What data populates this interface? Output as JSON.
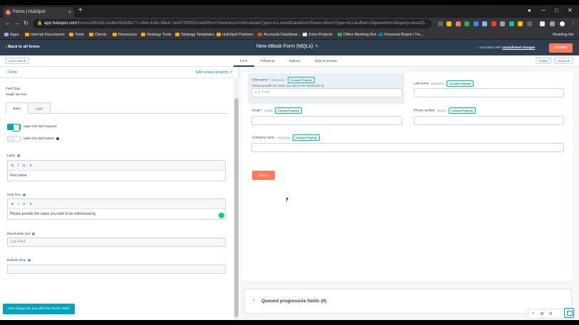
{
  "browser": {
    "tab_title": "Forms | HubSpot",
    "tab_close": "×",
    "new_tab": "+",
    "url_host": "app.hubspot.com",
    "url_path": "/forms/2661831/editor/8d5dfe77-c4b4-416e-98e4-7a49705f0501/edit/form?businessUnitId=&dateType=ALL&endDate&formTeam=&formType=ALL&offset=0&parentId=0&query=&sortD...",
    "bookmarks": [
      "Apps",
      "Internal Documents",
      "Tools",
      "Clients",
      "Resources",
      "Strategy Tools",
      "Strategy Templates",
      "HubSpot Partners",
      "Accounts Dashboar...",
      "Zoho Projects",
      "Office Working Rot...",
      "Personal Board | Tre..."
    ],
    "reading_list": "Reading list"
  },
  "header": {
    "back_label": "Back to all forms",
    "form_title": "New eBook Form (MQLs)",
    "autosave_prefix": "Automated with",
    "autosave_changes": "unpublished changes",
    "update_label": "Update"
  },
  "subheader": {
    "learn_more": "Learn more",
    "tabs": [
      "Form",
      "Follow-up",
      "Options",
      "Style & preview"
    ],
    "active_tab": "Form",
    "embed_label": "Embed",
    "actions_label": "Actions"
  },
  "left_panel": {
    "done_label": "Done",
    "edit_property_label": "Edit contact property",
    "field_type_label": "Field Type",
    "field_type_value": "Single line text",
    "tabs": [
      "Basic",
      "Logic"
    ],
    "required_toggle_label": "Make this field required",
    "required_on": true,
    "hidden_toggle_label": "Make this field hidden",
    "hidden_on": false,
    "label_label": "Label",
    "label_value": "First name",
    "help_text_label": "Help Text",
    "help_text_value": "Please provide the name you wish to be referenced by",
    "placeholder_label": "Placeholder text",
    "placeholder_value": "e.g. Fred",
    "default_label": "Default value",
    "default_value": "",
    "toolbar": [
      "B",
      "I",
      "U",
      "S"
    ],
    "feedback_label": "How happy are you with the Forms Tool?"
  },
  "form_preview": {
    "badge": "Contact Property",
    "fields": [
      {
        "label": "First name *",
        "internal": "firstname",
        "help": "Please provide the name you wish to be referenced by",
        "placeholder": "e.g. Fred"
      },
      {
        "label": "Last name",
        "internal": "lastname",
        "help": "",
        "placeholder": ""
      },
      {
        "label": "Email *",
        "internal": "email",
        "help": "",
        "placeholder": ""
      },
      {
        "label": "Phone number",
        "internal": "phone",
        "help": "",
        "placeholder": ""
      },
      {
        "label": "Company name",
        "internal": "company",
        "help": "",
        "placeholder": ""
      }
    ],
    "submit_label": "Submit",
    "queued_label": "Queued progressive fields (0)"
  },
  "colors": {
    "brand_orange": "#ff7a59",
    "header_navy": "#2d3e50",
    "accent_teal": "#00a4bd"
  }
}
